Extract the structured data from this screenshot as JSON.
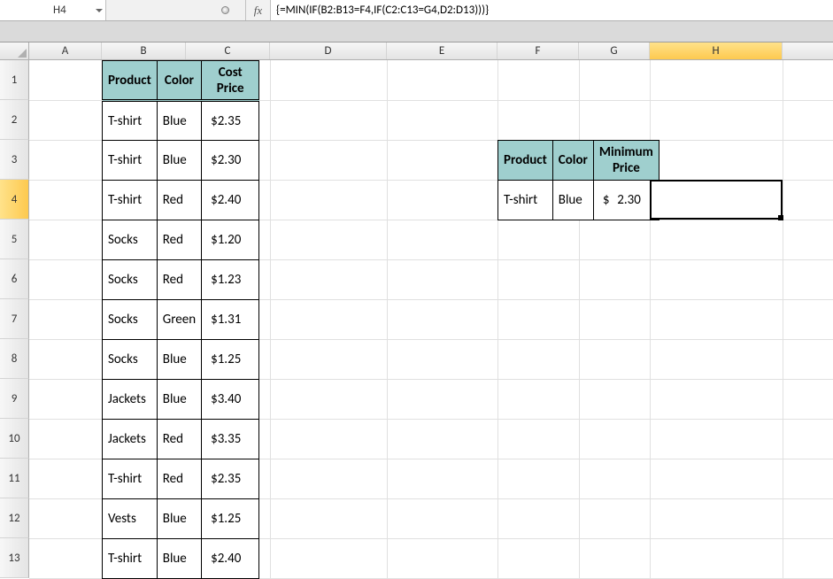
{
  "name_box": "H4",
  "fx_label": "fx",
  "formula": "{=MIN(IF(B2:B13=F4,IF(C2:C13=G4,D2:D13)))}",
  "columns": [
    "A",
    "B",
    "C",
    "D",
    "E",
    "F",
    "G",
    "H"
  ],
  "rows": [
    "1",
    "2",
    "3",
    "4",
    "5",
    "6",
    "7",
    "8",
    "9",
    "10",
    "11",
    "12",
    "13"
  ],
  "main_table": {
    "headers": {
      "b": "Product",
      "c": "Color",
      "d": "Cost Price"
    },
    "rows": [
      {
        "product": "T-shirt",
        "color": "Blue",
        "currency": "$",
        "price": "2.35"
      },
      {
        "product": "T-shirt",
        "color": "Blue",
        "currency": "$",
        "price": "2.30"
      },
      {
        "product": "T-shirt",
        "color": "Red",
        "currency": "$",
        "price": "2.40"
      },
      {
        "product": "Socks",
        "color": "Red",
        "currency": "$",
        "price": "1.20"
      },
      {
        "product": "Socks",
        "color": "Red",
        "currency": "$",
        "price": "1.23"
      },
      {
        "product": "Socks",
        "color": "Green",
        "currency": "$",
        "price": "1.31"
      },
      {
        "product": "Socks",
        "color": "Blue",
        "currency": "$",
        "price": "1.25"
      },
      {
        "product": "Jackets",
        "color": "Blue",
        "currency": "$",
        "price": "3.40"
      },
      {
        "product": "Jackets",
        "color": "Red",
        "currency": "$",
        "price": "3.35"
      },
      {
        "product": "T-shirt",
        "color": "Red",
        "currency": "$",
        "price": "2.35"
      },
      {
        "product": "Vests",
        "color": "Blue",
        "currency": "$",
        "price": "1.25"
      },
      {
        "product": "T-shirt",
        "color": "Blue",
        "currency": "$",
        "price": "2.40"
      }
    ]
  },
  "lookup_table": {
    "headers": {
      "f": "Product",
      "g": "Color",
      "h": "Minimum Price"
    },
    "row": {
      "product": "T-shirt",
      "color": "Blue",
      "currency": "$",
      "price": "2.30"
    }
  },
  "active_cell": {
    "col": "H",
    "row": 4
  }
}
